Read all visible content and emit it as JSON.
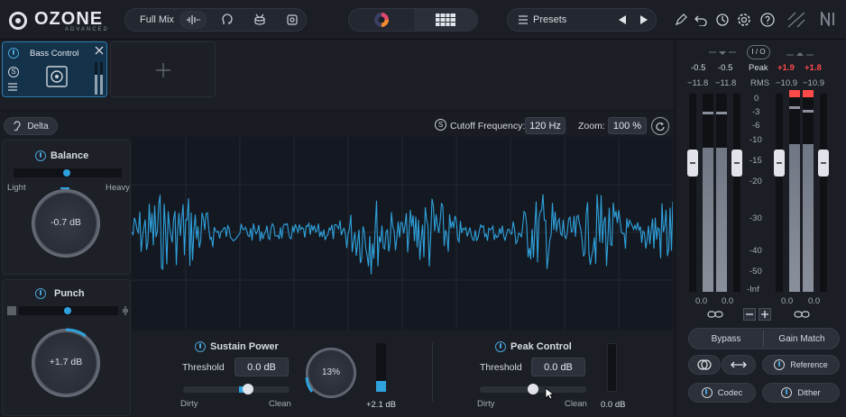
{
  "app": {
    "logo": "OZONE",
    "logo_sub": "ADVANCED"
  },
  "topbar": {
    "full_mix": "Full Mix",
    "presets": "Presets"
  },
  "module": {
    "name": "Bass Control",
    "power_on": true
  },
  "delta": "Delta",
  "cutoff": {
    "label": "Cutoff Frequency:",
    "value": "120 Hz"
  },
  "zoom": {
    "label": "Zoom:",
    "value": "100 %"
  },
  "balance": {
    "title": "Balance",
    "left": "Light",
    "right": "Heavy",
    "value": "-0.7 dB",
    "slider": 0.5
  },
  "punch": {
    "title": "Punch",
    "value": "+1.7 dB",
    "slider": 0.5
  },
  "sustain": {
    "title": "Sustain Power",
    "threshold_label": "Threshold",
    "threshold": "0.0 dB",
    "left": "Dirty",
    "right": "Clean",
    "slider": 0.6,
    "knob": "13%",
    "meter_value": "+2.1 dB",
    "meter_level": 0.22
  },
  "peak": {
    "title": "Peak Control",
    "threshold_label": "Threshold",
    "threshold": "0.0 dB",
    "left": "Dirty",
    "right": "Clean",
    "slider": 0.5,
    "meter_value": "0.0 dB"
  },
  "meters": {
    "io": "I / O",
    "peak_label": "Peak",
    "rms_label": "RMS",
    "in_peak": [
      "-0.5",
      "-0.5"
    ],
    "out_peak": [
      "+1.9",
      "+1.8"
    ],
    "in_rms": [
      "−11.8",
      "−11.8"
    ],
    "out_rms": [
      "−10.9",
      "−10.9"
    ],
    "scale": [
      "0",
      "-3",
      "-6",
      "-10",
      "-15",
      "-20",
      "-30",
      "-40",
      "-50",
      "-Inf"
    ],
    "gain_in": [
      "0.0",
      "0.0"
    ],
    "gain_out": [
      "0.0",
      "0.0"
    ]
  },
  "buttons": {
    "bypass": "Bypass",
    "gain_match": "Gain Match",
    "reference": "Reference",
    "codec": "Codec",
    "dither": "Dither"
  },
  "colors": {
    "accent": "#2fa2dd",
    "red": "#ff4a4a"
  }
}
